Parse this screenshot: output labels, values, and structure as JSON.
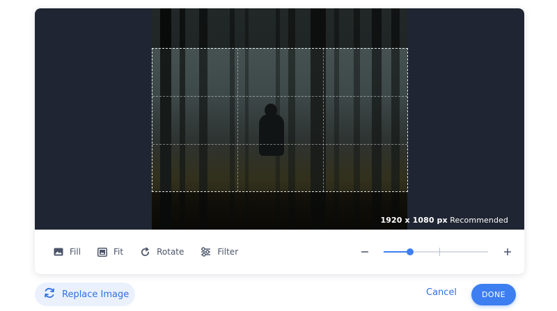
{
  "editor": {
    "resolution": "1920 x 1080 px",
    "recommended": "Recommended",
    "image_alt": "Person running through a misty forest"
  },
  "toolbar": {
    "tools": [
      {
        "label": "Fill",
        "icon": "image-fill-icon"
      },
      {
        "label": "Fit",
        "icon": "image-fit-icon"
      },
      {
        "label": "Rotate",
        "icon": "rotate-icon"
      },
      {
        "label": "Filter",
        "icon": "sliders-icon"
      }
    ],
    "zoom": {
      "value_fraction": 0.25,
      "minus_icon": "minus-icon",
      "plus_icon": "plus-icon"
    }
  },
  "footer": {
    "replace_label": "Replace Image",
    "replace_icon": "refresh-icon",
    "cancel_label": "Cancel",
    "done_label": "DONE"
  },
  "colors": {
    "accent": "#3d7ef0",
    "editor_bg": "#1f2532",
    "tool_text": "#4a5368",
    "replace_bg": "#eaf1fd"
  }
}
